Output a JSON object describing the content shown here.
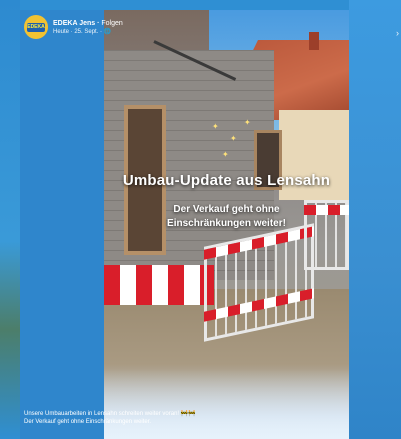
{
  "post": {
    "page_name": "EDEKA Jens",
    "follow_label": "Folgen",
    "date": "Heute · 25. Sept. · 🌐",
    "avatar_text": "EDEKA"
  },
  "photo": {
    "headline": "Umbau-Update aus Lensahn",
    "subline_1": "Der Verkauf geht ohne",
    "subline_2": "Einschränkungen weiter!"
  },
  "caption": {
    "line_1": "Unsere Umbauarbeiten in Lensahn schreiten weiter voran! 🚧🚧",
    "line_2": "Der Verkauf geht ohne Einschränkungen weiter."
  },
  "icons": {
    "more": "more-icon"
  },
  "colors": {
    "background_blue": "#2f8fd3",
    "barrier_red": "#d91e2a"
  }
}
